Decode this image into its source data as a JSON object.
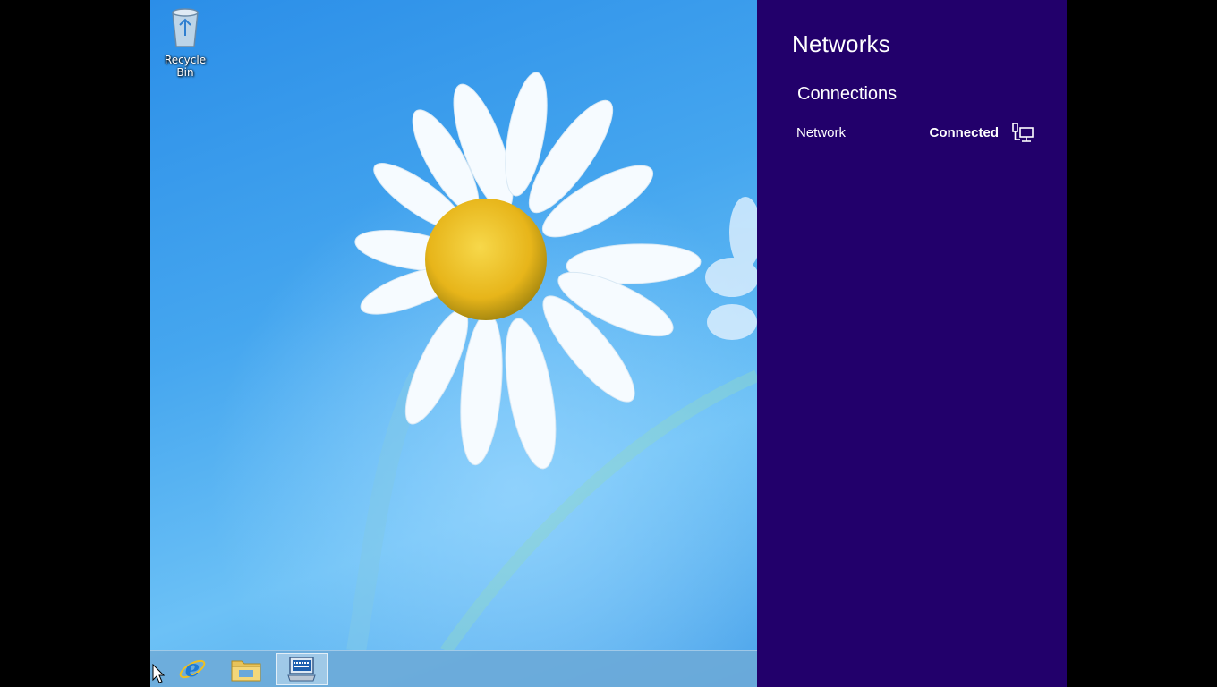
{
  "desktop": {
    "icons": [
      {
        "label": "Recycle Bin",
        "icon": "recycle-bin-icon"
      }
    ]
  },
  "taskbar": {
    "items": [
      {
        "icon": "internet-explorer-icon"
      },
      {
        "icon": "file-explorer-icon"
      },
      {
        "icon": "on-screen-keyboard-icon",
        "active": true
      }
    ]
  },
  "charm": {
    "title": "Networks",
    "section_title": "Connections",
    "connections": [
      {
        "name": "Network",
        "status": "Connected",
        "icon": "wired-network-icon"
      }
    ],
    "background_color": "#22006b"
  }
}
